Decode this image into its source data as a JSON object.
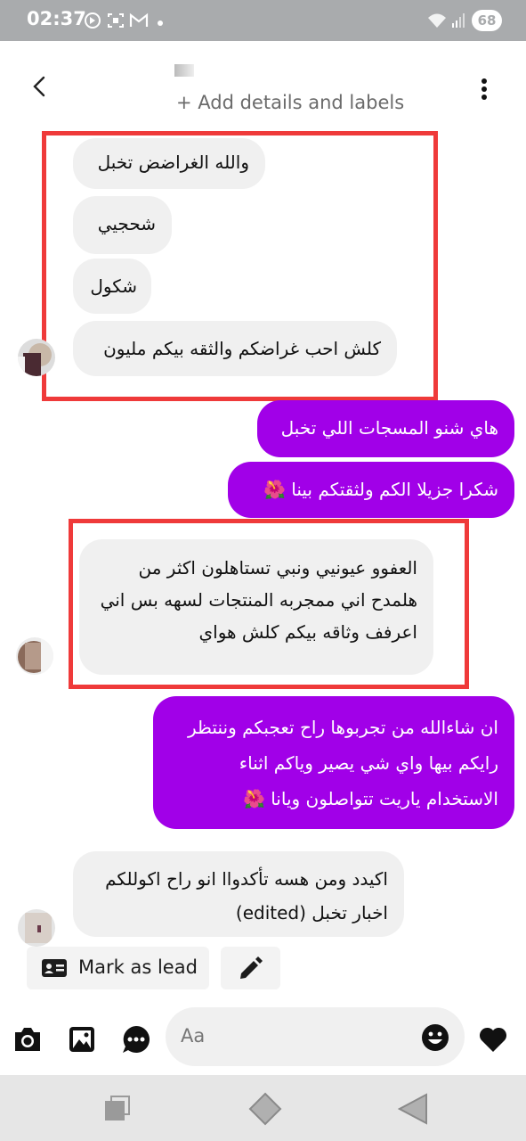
{
  "status_bar": {
    "time": "02:37",
    "battery": "68",
    "icons": [
      "sync-icon",
      "screenshot-icon",
      "gmail-icon",
      "wifi-icon",
      "signal-icon"
    ]
  },
  "header": {
    "back_icon": "chevron-left-icon",
    "subtitle": "+ Add details and labels",
    "menu_icon": "kebab-menu-icon"
  },
  "messages": [
    {
      "dir": "in",
      "text": "والله الغراضض تخبل"
    },
    {
      "dir": "in",
      "text": "شحجيي"
    },
    {
      "dir": "in",
      "text": "شكول"
    },
    {
      "dir": "in",
      "text": "كلش احب غراضكم والثقه بيكم مليون"
    },
    {
      "dir": "out",
      "text": "هاي شنو المسجات اللي تخبل"
    },
    {
      "dir": "out",
      "text": "شكرا جزيلا الكم ولثقتكم بينا 🌺"
    },
    {
      "dir": "in",
      "lines": [
        "العفوو عيونيي ونبي تستاهلون اكثر من",
        "هلمدح اني ممجربه المنتجات لسهه بس اني",
        "اعرفف وثاقه بيكم كلش هواي"
      ]
    },
    {
      "dir": "out",
      "lines": [
        "ان شاءالله من تجربوها راح تعجبكم وننتظر",
        "رايكم بيها واي شي يصير وياكم اثناء",
        "الاستخدام ياريت تتواصلون ويانا 🌺"
      ]
    },
    {
      "dir": "in",
      "lines": [
        "اكيدد ومن هسه تأكدواا انو راح اكوللكم",
        "اخبار تخبل  (edited)"
      ]
    }
  ],
  "actions": {
    "mark_as_lead": "Mark as lead",
    "lead_icon": "contact-card-icon",
    "edit_icon": "pencil-icon"
  },
  "composer": {
    "placeholder": "Aa",
    "icons": [
      "camera-icon",
      "gallery-icon",
      "chat-bubble-icon",
      "emoji-icon",
      "heart-icon"
    ]
  },
  "nav": {
    "icons": [
      "recents-icon",
      "home-icon",
      "back-icon"
    ]
  },
  "colors": {
    "outgoing_bubble": "#a100e8",
    "incoming_bubble": "#f0f0f0",
    "highlight_box": "#ef3a3a",
    "status_bar": "#a9abad"
  }
}
